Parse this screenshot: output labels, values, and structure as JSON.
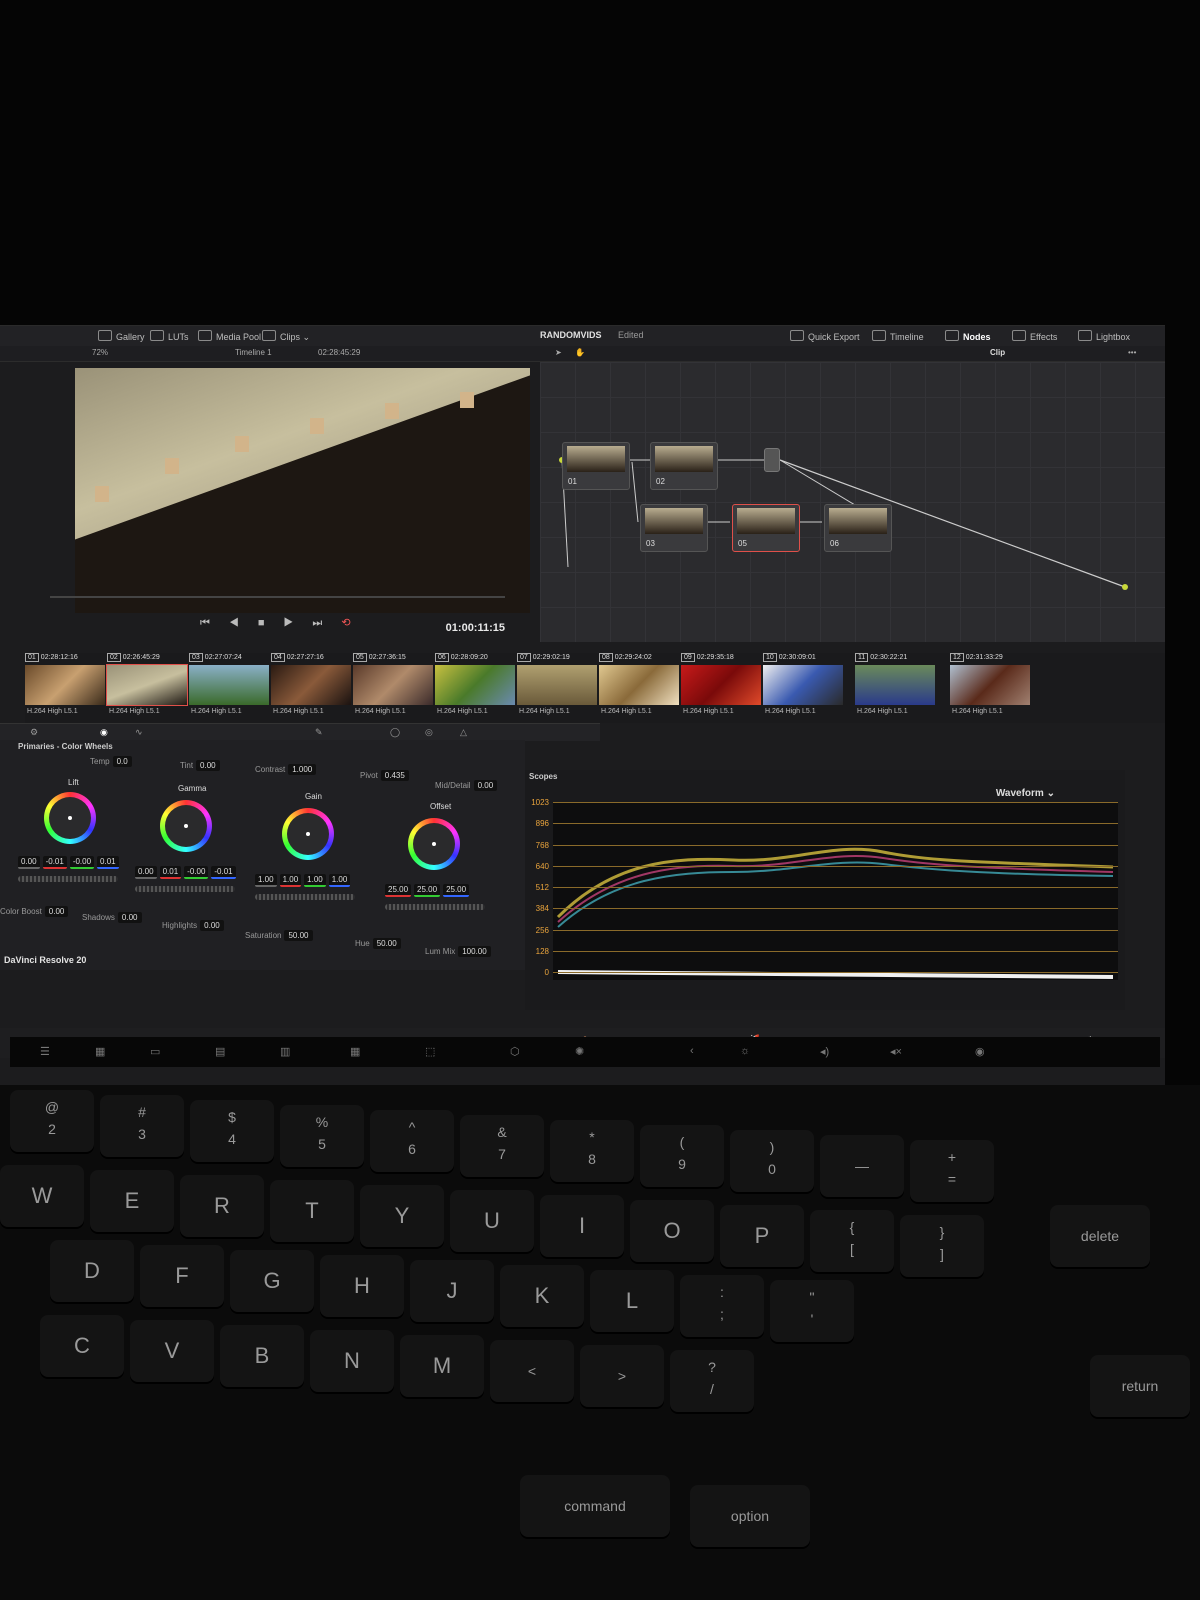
{
  "topbar": {
    "gallery": "Gallery",
    "luts": "LUTs",
    "media_pool": "Media Pool",
    "clips": "Clips",
    "project": "RANDOMVIDS",
    "status": "Edited",
    "quick_export": "Quick Export",
    "timeline": "Timeline",
    "nodes": "Nodes",
    "effects": "Effects",
    "lightbox": "Lightbox"
  },
  "toolbar": {
    "zoom": "72%",
    "timeline_name": "Timeline 1",
    "timecode": "02:28:45:29",
    "clip_mode": "Clip"
  },
  "viewer": {
    "timecode": "01:00:11:15"
  },
  "nodes": [
    {
      "label": "01"
    },
    {
      "label": "02"
    },
    {
      "label": "03"
    },
    {
      "label": "05"
    },
    {
      "label": "06"
    }
  ],
  "clips": [
    {
      "num": "01",
      "tc": "02:28:12:16",
      "codec": "H.264 High L5.1"
    },
    {
      "num": "02",
      "tc": "02:26:45:29",
      "codec": "H.264 High L5.1"
    },
    {
      "num": "03",
      "tc": "02:27:07:24",
      "codec": "H.264 High L5.1"
    },
    {
      "num": "04",
      "tc": "02:27:27:16",
      "codec": "H.264 High L5.1"
    },
    {
      "num": "05",
      "tc": "02:27:36:15",
      "codec": "H.264 High L5.1"
    },
    {
      "num": "06",
      "tc": "02:28:09:20",
      "codec": "H.264 High L5.1"
    },
    {
      "num": "07",
      "tc": "02:29:02:19",
      "codec": "H.264 High L5.1"
    },
    {
      "num": "08",
      "tc": "02:29:24:02",
      "codec": "H.264 High L5.1"
    },
    {
      "num": "09",
      "tc": "02:29:35:18",
      "codec": "H.264 High L5.1"
    },
    {
      "num": "10",
      "tc": "02:30:09:01",
      "codec": "H.264 High L5.1"
    },
    {
      "num": "11",
      "tc": "02:30:22:21",
      "codec": "H.264 High L5.1"
    },
    {
      "num": "12",
      "tc": "02:31:33:29",
      "codec": "H.264 High L5.1"
    }
  ],
  "primaries": {
    "title": "Primaries - Color Wheels",
    "temp_label": "Temp",
    "temp": "0.0",
    "tint_label": "Tint",
    "tint": "0.00",
    "contrast_label": "Contrast",
    "contrast": "1.000",
    "pivot_label": "Pivot",
    "pivot": "0.435",
    "middetail_label": "Mid/Detail",
    "middetail": "0.00",
    "lift_label": "Lift",
    "lift": [
      "0.00",
      "-0.01",
      "-0.00",
      "0.01"
    ],
    "gamma_label": "Gamma",
    "gamma": [
      "0.00",
      "0.01",
      "-0.00",
      "-0.01"
    ],
    "gain_label": "Gain",
    "gain": [
      "1.00",
      "1.00",
      "1.00",
      "1.00"
    ],
    "offset_label": "Offset",
    "offset": [
      "25.00",
      "25.00",
      "25.00"
    ],
    "colorboost_label": "Color Boost",
    "colorboost": "0.00",
    "shadows_label": "Shadows",
    "shadows": "0.00",
    "highlights_label": "Highlights",
    "highlights": "0.00",
    "saturation_label": "Saturation",
    "saturation": "50.00",
    "hue_label": "Hue",
    "hue": "50.00",
    "lummix_label": "Lum Mix",
    "lummix": "100.00",
    "app_name": "DaVinci Resolve 20"
  },
  "scopes": {
    "title": "Scopes",
    "mode": "Waveform",
    "ticks": [
      "1023",
      "896",
      "768",
      "640",
      "512",
      "384",
      "256",
      "128",
      "0"
    ]
  },
  "keyboard": {
    "row1": [
      "@\n2",
      "#\n3",
      "$\n4",
      "%\n5",
      "^\n6",
      "&\n7",
      "*\n8",
      "(\n9",
      ")\n0",
      "—",
      "+\n="
    ],
    "row2": [
      "W",
      "E",
      "R",
      "T",
      "Y",
      "U",
      "I",
      "O",
      "P",
      "{\n[",
      "}\n]"
    ],
    "row3": [
      "D",
      "F",
      "G",
      "H",
      "J",
      "K",
      "L",
      ":\n;",
      "\"\n'"
    ],
    "row4": [
      "C",
      "V",
      "B",
      "N",
      "M",
      "<",
      ">",
      "?\n/"
    ],
    "delete": "delete",
    "return": "return",
    "command": "command",
    "option": "option"
  }
}
